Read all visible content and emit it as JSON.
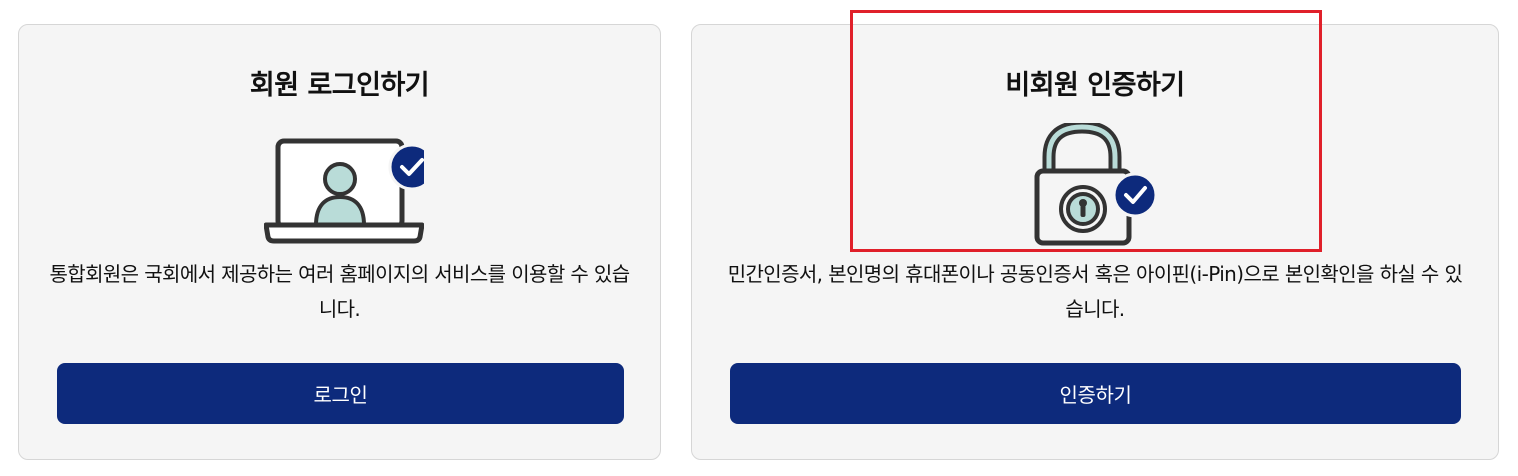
{
  "member": {
    "title": "회원 로그인하기",
    "description": "통합회원은 국회에서 제공하는 여러 홈페이지의 서비스를 이용할 수 있습니다.",
    "button_label": "로그인",
    "icon": "laptop-user-check-icon"
  },
  "nonmember": {
    "title": "비회원 인증하기",
    "description": "민간인증서, 본인명의 휴대폰이나 공동인증서 혹은 아이핀(i-Pin)으로 본인확인을 하실 수 있습니다.",
    "button_label": "인증하기",
    "icon": "padlock-check-icon"
  },
  "colors": {
    "button_bg": "#0d2a7c",
    "card_bg": "#f5f5f5",
    "highlight_border": "#e0202a",
    "icon_accent": "#b9dcd8"
  }
}
